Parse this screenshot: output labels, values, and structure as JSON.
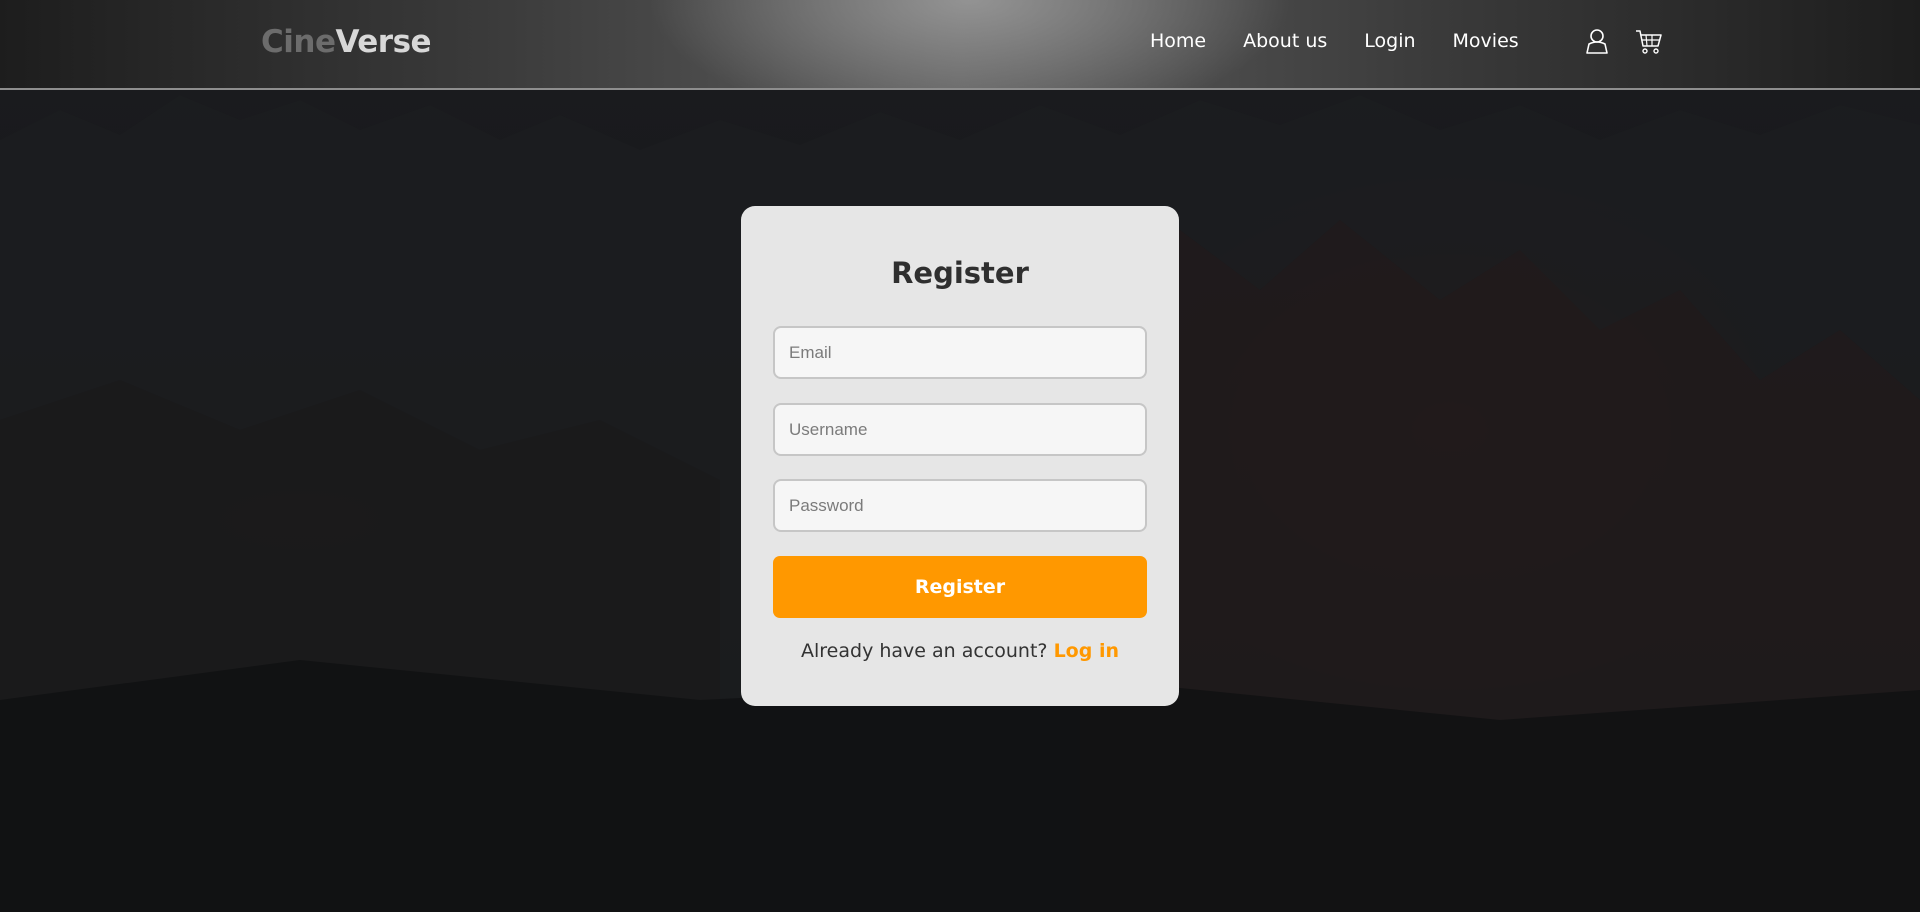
{
  "brand": {
    "part1": "Cine",
    "part2": "Verse"
  },
  "nav": {
    "items": [
      {
        "label": "Home"
      },
      {
        "label": "About us"
      },
      {
        "label": "Login"
      },
      {
        "label": "Movies"
      }
    ],
    "icons": [
      "user-icon",
      "cart-icon"
    ]
  },
  "form": {
    "title": "Register",
    "email_placeholder": "Email",
    "username_placeholder": "Username",
    "password_placeholder": "Password",
    "submit_label": "Register",
    "account_prompt": "Already have an account?",
    "login_link": "Log in"
  },
  "colors": {
    "accent": "#ff9800",
    "card_bg": "#e6e6e6",
    "page_bg": "#121315"
  }
}
